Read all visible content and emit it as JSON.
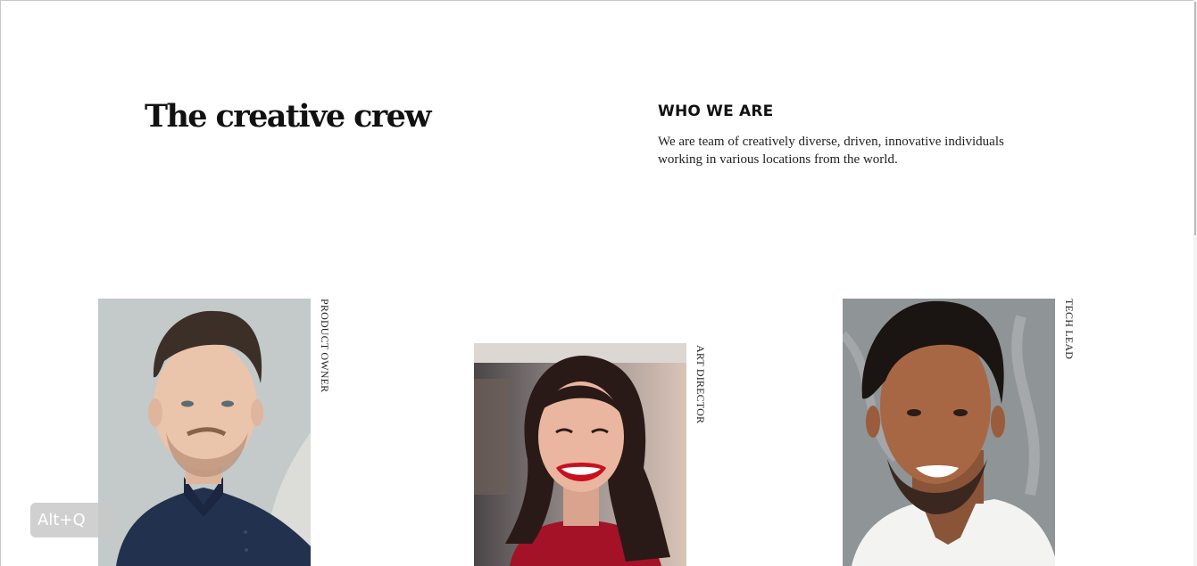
{
  "page": {
    "title": "The creative crew"
  },
  "about": {
    "heading": "WHO WE ARE",
    "text": "We are team of creatively diverse, driven, innovative individuals working in various locations from the world."
  },
  "team": [
    {
      "role": "PRODUCT OWNER"
    },
    {
      "role": "ART DIRECTOR"
    },
    {
      "role": "TECH LEAD"
    }
  ],
  "overlay": {
    "hotkey_label": "Alt+Q"
  },
  "colors": {
    "text": "#111111",
    "background": "#ffffff"
  }
}
